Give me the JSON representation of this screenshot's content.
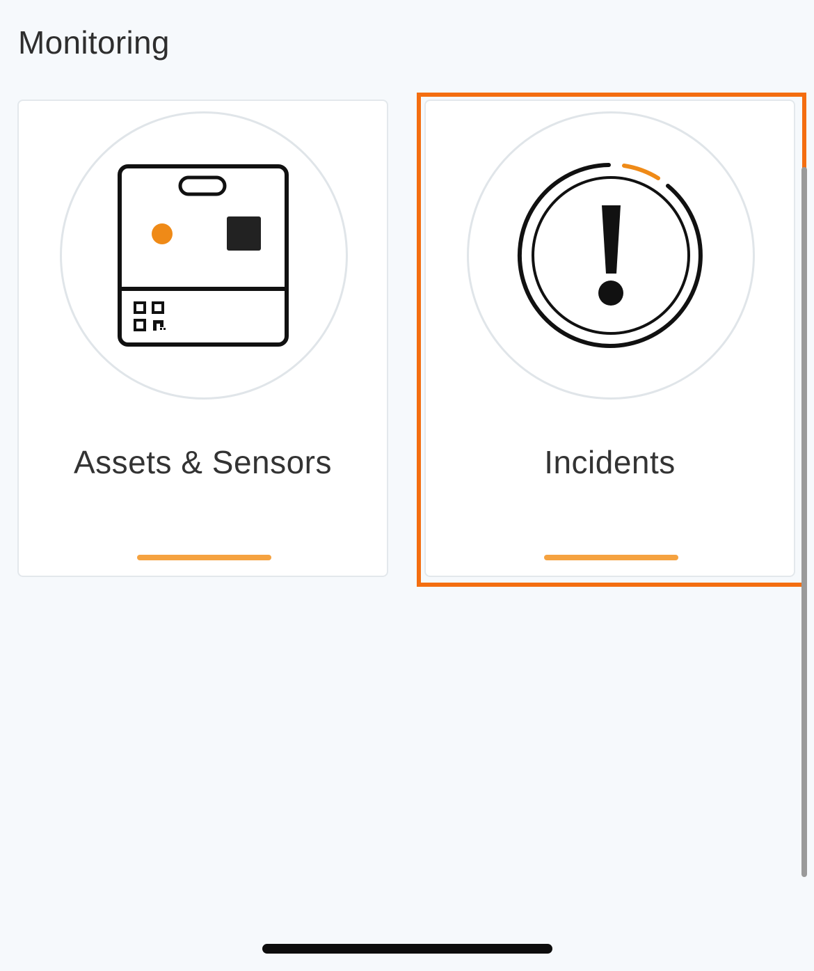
{
  "section": {
    "title": "Monitoring"
  },
  "cards": [
    {
      "label": "Assets & Sensors",
      "icon": "asset-sensor-device-icon"
    },
    {
      "label": "Incidents",
      "icon": "incident-alert-icon",
      "selected": true
    }
  ],
  "colors": {
    "accent": "#f5a240",
    "selection": "#f46e10",
    "background": "#f6f9fc"
  }
}
